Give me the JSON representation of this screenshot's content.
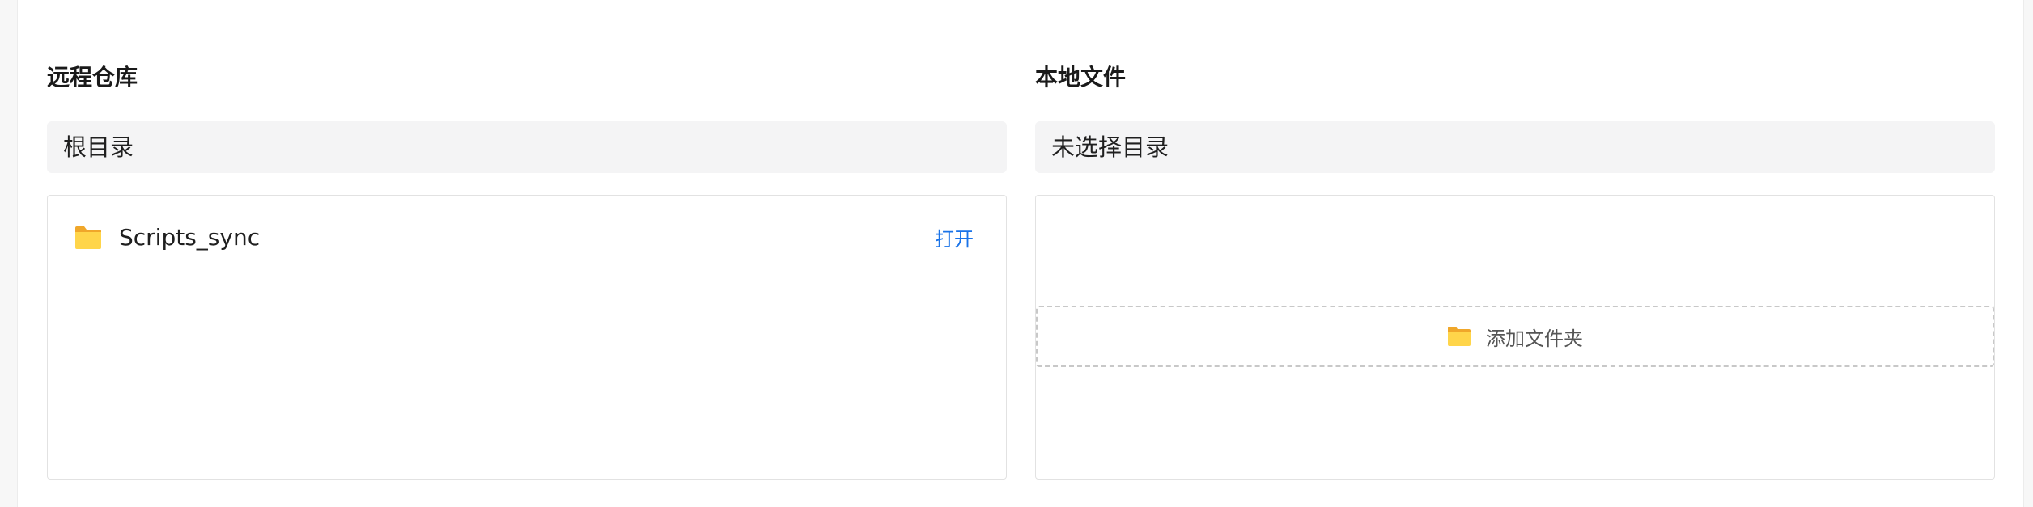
{
  "remote": {
    "title": "远程仓库",
    "path": "根目录",
    "items": [
      {
        "name": "Scripts_sync",
        "icon": "folder-icon",
        "action_label": "打开"
      }
    ]
  },
  "local": {
    "title": "本地文件",
    "path": "未选择目录",
    "add_folder_label": "添加文件夹",
    "add_folder_icon": "folder-icon"
  },
  "colors": {
    "accent_link": "#1a73e8",
    "folder": "#f5c842",
    "path_bar_bg": "#f4f4f5"
  }
}
